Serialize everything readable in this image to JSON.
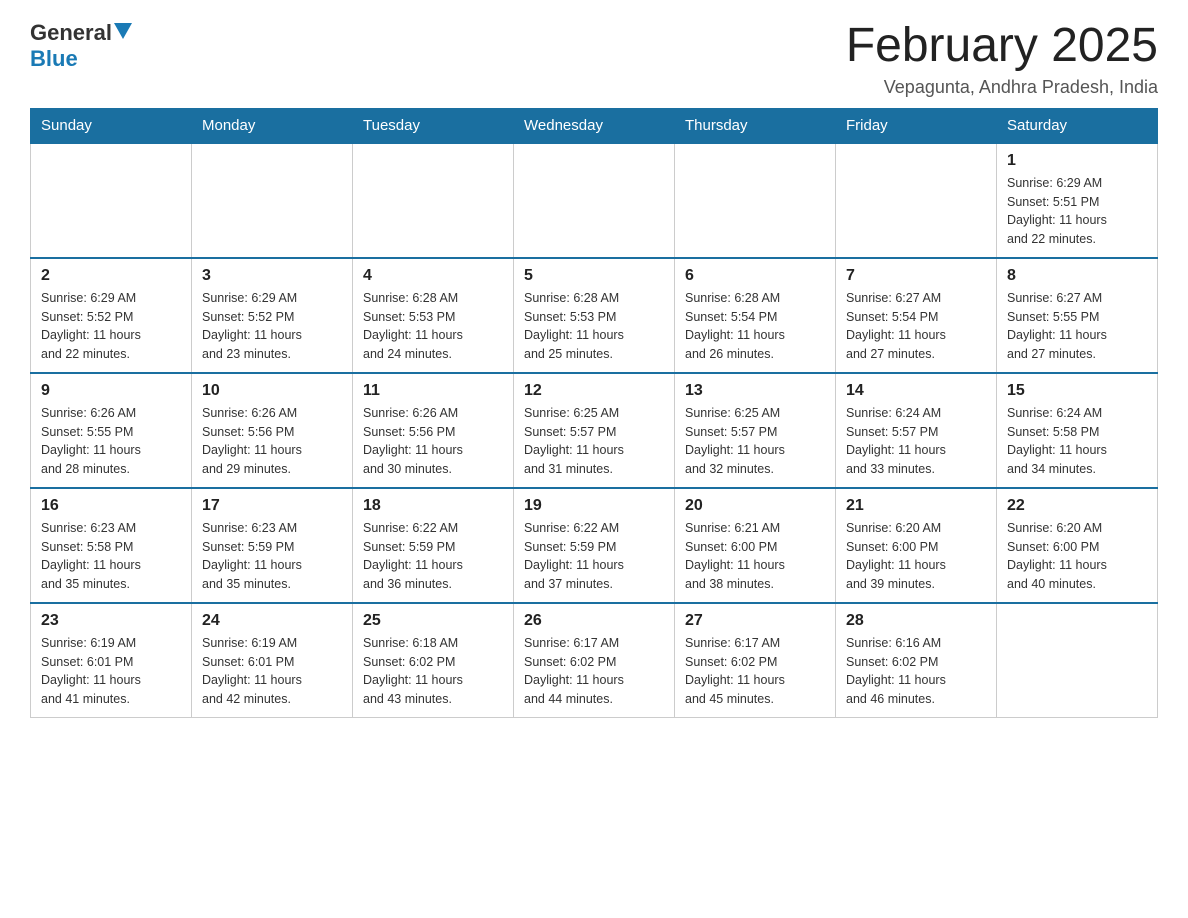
{
  "logo": {
    "general": "General",
    "blue": "Blue"
  },
  "header": {
    "title": "February 2025",
    "subtitle": "Vepagunta, Andhra Pradesh, India"
  },
  "weekdays": [
    "Sunday",
    "Monday",
    "Tuesday",
    "Wednesday",
    "Thursday",
    "Friday",
    "Saturday"
  ],
  "weeks": [
    [
      {
        "day": "",
        "info": ""
      },
      {
        "day": "",
        "info": ""
      },
      {
        "day": "",
        "info": ""
      },
      {
        "day": "",
        "info": ""
      },
      {
        "day": "",
        "info": ""
      },
      {
        "day": "",
        "info": ""
      },
      {
        "day": "1",
        "info": "Sunrise: 6:29 AM\nSunset: 5:51 PM\nDaylight: 11 hours\nand 22 minutes."
      }
    ],
    [
      {
        "day": "2",
        "info": "Sunrise: 6:29 AM\nSunset: 5:52 PM\nDaylight: 11 hours\nand 22 minutes."
      },
      {
        "day": "3",
        "info": "Sunrise: 6:29 AM\nSunset: 5:52 PM\nDaylight: 11 hours\nand 23 minutes."
      },
      {
        "day": "4",
        "info": "Sunrise: 6:28 AM\nSunset: 5:53 PM\nDaylight: 11 hours\nand 24 minutes."
      },
      {
        "day": "5",
        "info": "Sunrise: 6:28 AM\nSunset: 5:53 PM\nDaylight: 11 hours\nand 25 minutes."
      },
      {
        "day": "6",
        "info": "Sunrise: 6:28 AM\nSunset: 5:54 PM\nDaylight: 11 hours\nand 26 minutes."
      },
      {
        "day": "7",
        "info": "Sunrise: 6:27 AM\nSunset: 5:54 PM\nDaylight: 11 hours\nand 27 minutes."
      },
      {
        "day": "8",
        "info": "Sunrise: 6:27 AM\nSunset: 5:55 PM\nDaylight: 11 hours\nand 27 minutes."
      }
    ],
    [
      {
        "day": "9",
        "info": "Sunrise: 6:26 AM\nSunset: 5:55 PM\nDaylight: 11 hours\nand 28 minutes."
      },
      {
        "day": "10",
        "info": "Sunrise: 6:26 AM\nSunset: 5:56 PM\nDaylight: 11 hours\nand 29 minutes."
      },
      {
        "day": "11",
        "info": "Sunrise: 6:26 AM\nSunset: 5:56 PM\nDaylight: 11 hours\nand 30 minutes."
      },
      {
        "day": "12",
        "info": "Sunrise: 6:25 AM\nSunset: 5:57 PM\nDaylight: 11 hours\nand 31 minutes."
      },
      {
        "day": "13",
        "info": "Sunrise: 6:25 AM\nSunset: 5:57 PM\nDaylight: 11 hours\nand 32 minutes."
      },
      {
        "day": "14",
        "info": "Sunrise: 6:24 AM\nSunset: 5:57 PM\nDaylight: 11 hours\nand 33 minutes."
      },
      {
        "day": "15",
        "info": "Sunrise: 6:24 AM\nSunset: 5:58 PM\nDaylight: 11 hours\nand 34 minutes."
      }
    ],
    [
      {
        "day": "16",
        "info": "Sunrise: 6:23 AM\nSunset: 5:58 PM\nDaylight: 11 hours\nand 35 minutes."
      },
      {
        "day": "17",
        "info": "Sunrise: 6:23 AM\nSunset: 5:59 PM\nDaylight: 11 hours\nand 35 minutes."
      },
      {
        "day": "18",
        "info": "Sunrise: 6:22 AM\nSunset: 5:59 PM\nDaylight: 11 hours\nand 36 minutes."
      },
      {
        "day": "19",
        "info": "Sunrise: 6:22 AM\nSunset: 5:59 PM\nDaylight: 11 hours\nand 37 minutes."
      },
      {
        "day": "20",
        "info": "Sunrise: 6:21 AM\nSunset: 6:00 PM\nDaylight: 11 hours\nand 38 minutes."
      },
      {
        "day": "21",
        "info": "Sunrise: 6:20 AM\nSunset: 6:00 PM\nDaylight: 11 hours\nand 39 minutes."
      },
      {
        "day": "22",
        "info": "Sunrise: 6:20 AM\nSunset: 6:00 PM\nDaylight: 11 hours\nand 40 minutes."
      }
    ],
    [
      {
        "day": "23",
        "info": "Sunrise: 6:19 AM\nSunset: 6:01 PM\nDaylight: 11 hours\nand 41 minutes."
      },
      {
        "day": "24",
        "info": "Sunrise: 6:19 AM\nSunset: 6:01 PM\nDaylight: 11 hours\nand 42 minutes."
      },
      {
        "day": "25",
        "info": "Sunrise: 6:18 AM\nSunset: 6:02 PM\nDaylight: 11 hours\nand 43 minutes."
      },
      {
        "day": "26",
        "info": "Sunrise: 6:17 AM\nSunset: 6:02 PM\nDaylight: 11 hours\nand 44 minutes."
      },
      {
        "day": "27",
        "info": "Sunrise: 6:17 AM\nSunset: 6:02 PM\nDaylight: 11 hours\nand 45 minutes."
      },
      {
        "day": "28",
        "info": "Sunrise: 6:16 AM\nSunset: 6:02 PM\nDaylight: 11 hours\nand 46 minutes."
      },
      {
        "day": "",
        "info": ""
      }
    ]
  ]
}
